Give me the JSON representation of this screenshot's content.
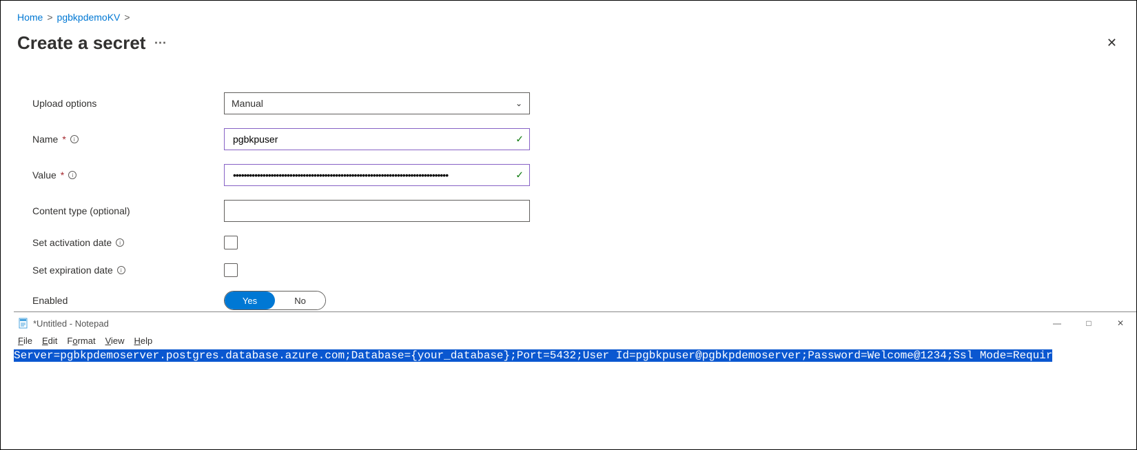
{
  "breadcrumb": {
    "home": "Home",
    "kv": "pgbkpdemoKV"
  },
  "page": {
    "title": "Create a secret"
  },
  "form": {
    "upload_options": {
      "label": "Upload options",
      "value": "Manual"
    },
    "name": {
      "label": "Name",
      "value": "pgbkpuser"
    },
    "value": {
      "label": "Value",
      "value": "••••••••••••••••••••••••••••••••••••••••••••••••••••••••••••••••••••••••••••••••"
    },
    "content_type": {
      "label": "Content type (optional)",
      "value": ""
    },
    "activation": {
      "label": "Set activation date",
      "checked": false
    },
    "expiration": {
      "label": "Set expiration date",
      "checked": false
    },
    "enabled": {
      "label": "Enabled",
      "yes": "Yes",
      "no": "No",
      "value": true
    }
  },
  "notepad": {
    "title": "*Untitled - Notepad",
    "menu": {
      "file": "File",
      "edit": "Edit",
      "format": "Format",
      "view": "View",
      "help": "Help"
    },
    "content": "Server=pgbkpdemoserver.postgres.database.azure.com;Database={your_database};Port=5432;User Id=pgbkpuser@pgbkpdemoserver;Password=Welcome@1234;Ssl Mode=Requir"
  }
}
